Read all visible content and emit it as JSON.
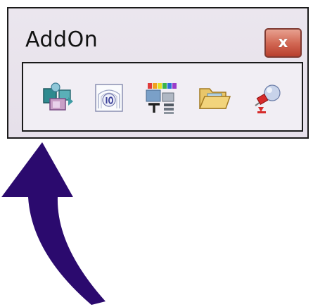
{
  "window": {
    "title": "AddOn",
    "close_label": "x"
  },
  "toolbar": {
    "buttons": [
      {
        "name": "scene-objects-icon"
      },
      {
        "name": "dimension-icon"
      },
      {
        "name": "color-palette-text-icon"
      },
      {
        "name": "folder-open-icon"
      },
      {
        "name": "pushpin-marker-icon"
      }
    ]
  },
  "annotation": {
    "arrow_color": "#2b0a6e"
  },
  "colors": {
    "window_background": "#e6e0ea",
    "close_button": "#c9543f",
    "border": "#1a1a1a"
  }
}
